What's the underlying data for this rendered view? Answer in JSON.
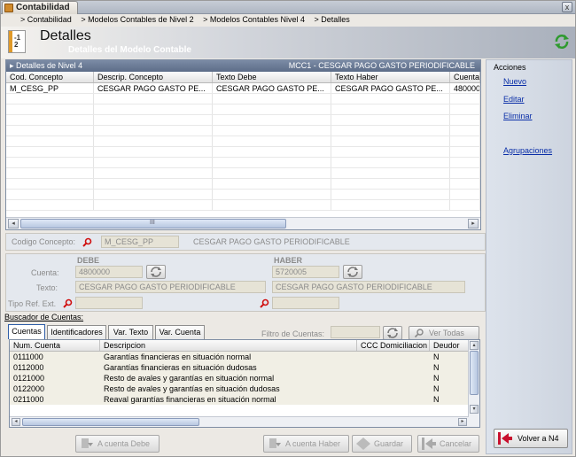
{
  "app": {
    "tab_label": "Contabilidad",
    "close_glyph": "x"
  },
  "breadcrumb": [
    "> Contabilidad",
    "> Modelos Contables de Nivel 2",
    "> Modelos Contables Nivel 4",
    "> Detalles"
  ],
  "header": {
    "title": "Detalles",
    "subtitle": "Detalles del Modelo Contable",
    "icon_text": "-1\n2"
  },
  "grid": {
    "title": "Detalles de Nivel 4",
    "right_caption": "MCC1 - CESGAR PAGO GASTO PERIODIFICABLE",
    "columns": [
      "Cod. Concepto",
      "Descrip. Concepto",
      "Texto Debe",
      "Texto Haber",
      "Cuenta"
    ],
    "rows": [
      [
        "M_CESG_PP",
        "CESGAR PAGO GASTO PE...",
        "CESGAR PAGO GASTO PE...",
        "CESGAR PAGO GASTO PE...",
        "480000"
      ]
    ],
    "scroll_grip": "III"
  },
  "actions": {
    "title": "Acciones",
    "links": [
      "Nuevo",
      "Editar",
      "Eliminar",
      "Agrupaciones"
    ],
    "back_label": "Volver a N4"
  },
  "concept": {
    "label": "Codigo Concepto:",
    "code": "M_CESG_PP",
    "description": "CESGAR PAGO GASTO PERIODIFICABLE"
  },
  "accounts": {
    "debe_header": "DEBE",
    "haber_header": "HABER",
    "cuenta_label": "Cuenta:",
    "texto_label": "Texto:",
    "tipo_ref_label": "Tipo Ref. Ext.",
    "debe_cuenta": "4800000",
    "debe_texto": "CESGAR PAGO GASTO PERIODIFICABLE",
    "haber_cuenta": "5720005",
    "haber_texto": "CESGAR PAGO GASTO PERIODIFICABLE"
  },
  "buscador": {
    "title": "Buscador de Cuentas:",
    "tabs": [
      "Cuentas",
      "Identificadores",
      "Var. Texto",
      "Var. Cuenta"
    ],
    "filter_label": "Filtro de Cuentas:",
    "ver_todas": "Ver Todas",
    "columns": [
      "Num. Cuenta",
      "Descripcion",
      "CCC Domiciliacion",
      "Deudor"
    ],
    "rows": [
      [
        "0111000",
        "Garantías financieras en situación normal",
        "",
        "N"
      ],
      [
        "0112000",
        "Garantías financieras en situación dudosas",
        "",
        "N"
      ],
      [
        "0121000",
        "Resto de avales y garantías en situación normal",
        "",
        "N"
      ],
      [
        "0122000",
        "Resto de avales y garantías en situación dudosas",
        "",
        "N"
      ],
      [
        "0211000",
        "Reaval garantías financieras en situación normal",
        "",
        "N"
      ]
    ]
  },
  "buttons": {
    "a_cuenta_debe": "A cuenta Debe",
    "a_cuenta_haber": "A cuenta Haber",
    "guardar": "Guardar",
    "cancelar": "Cancelar"
  }
}
